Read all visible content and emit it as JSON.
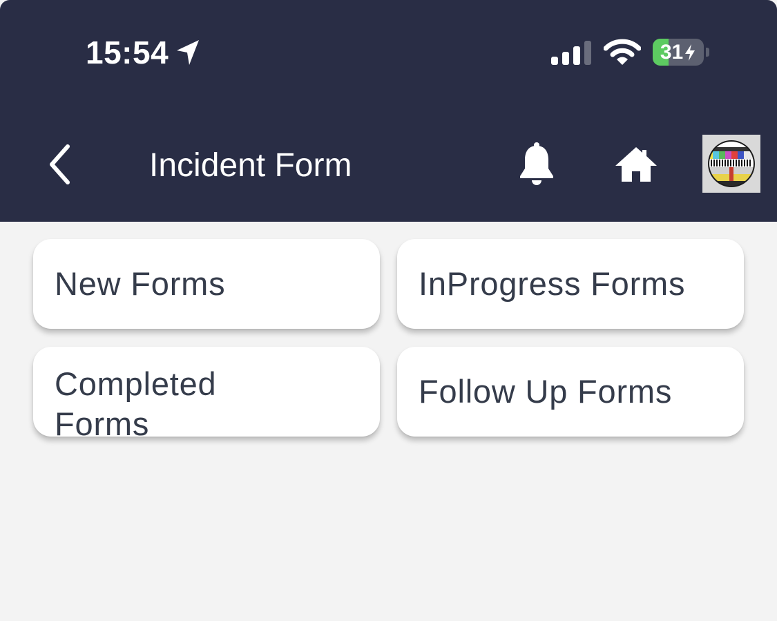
{
  "status_bar": {
    "time": "15:54",
    "battery_level": "31",
    "battery_fraction": 0.31,
    "icons": [
      "location-arrow-icon",
      "cellular-signal-icon",
      "wifi-icon",
      "battery-charging-icon"
    ]
  },
  "header": {
    "title": "Incident Form",
    "back_icon": "chevron-left-icon",
    "notification_icon": "bell-icon",
    "home_icon": "home-icon",
    "avatar_icon": "test-card-avatar"
  },
  "cards": {
    "new_forms": "New Forms",
    "inprogress_forms": "InProgress Forms",
    "completed_forms": "Completed Forms",
    "follow_up_forms": "Follow Up Forms"
  },
  "colors": {
    "header_bg": "#292d45",
    "page_bg": "#f3f3f3",
    "card_bg": "#ffffff",
    "card_text": "#353c4b",
    "battery_green": "#5dcb61"
  }
}
